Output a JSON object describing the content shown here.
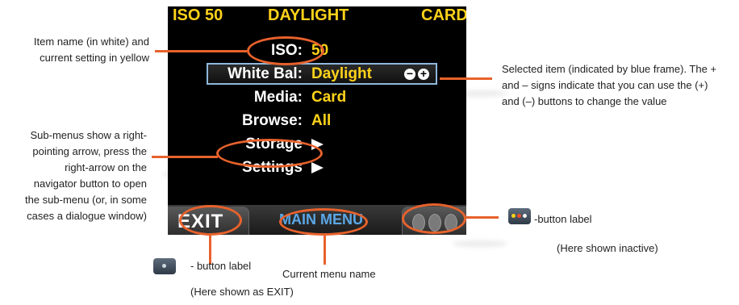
{
  "status_bar": {
    "iso": "ISO 50",
    "wb": "DAYLIGHT",
    "media": "CARD"
  },
  "menu_items": [
    {
      "name": "ISO:",
      "value": "50"
    },
    {
      "name": "White Bal:",
      "value": "Daylight"
    },
    {
      "name": "Media:",
      "value": "Card"
    },
    {
      "name": "Browse:",
      "value": "All"
    },
    {
      "name": "Storage",
      "value": ""
    },
    {
      "name": "Settings",
      "value": ""
    }
  ],
  "bottom_bar": {
    "left_label": "EXIT",
    "menu_name": "MAIN MENU"
  },
  "callouts": {
    "item_name": "Item name (in white) and current setting in yellow",
    "selected": "Selected item (indicated by blue frame). The + and – signs indicate that you can use the (+) and (–) buttons to change the value",
    "submenu": "Sub-menus show a right-pointing arrow, press the right-arrow on the navigator button to open the sub-menu (or, in some cases a dialogue window)",
    "button_label": "- button label",
    "button_shown": "(Here shown as EXIT)",
    "menu_name": "Current menu name",
    "three_label": "-button label",
    "three_shown": "(Here shown inactive)"
  },
  "icons": {
    "selected_controls": [
      "minus-circle-icon",
      "plus-circle-icon"
    ],
    "submenu": "right-arrow-icon",
    "three_dot_button": "three-dot-button-icon",
    "single_dot_button": "single-dot-button-icon"
  },
  "colors": {
    "setting": "#ffd21a",
    "item": "#ffffff",
    "frame": "#8fb7dc",
    "menu_name": "#5aa7e6",
    "callout": "#e8622c"
  }
}
